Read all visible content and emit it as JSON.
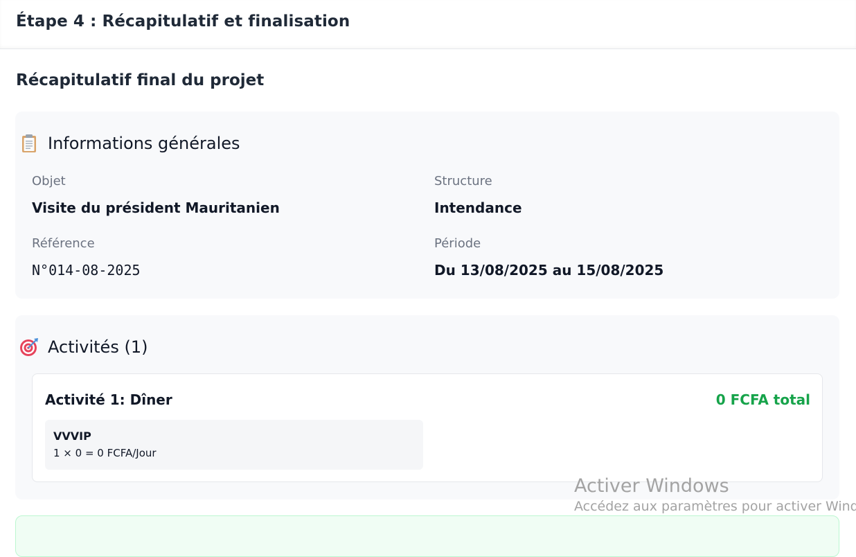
{
  "header": {
    "title": "Étape 4 : Récapitulatif et finalisation"
  },
  "summary": {
    "title": "Récapitulatif final du projet"
  },
  "general_info": {
    "icon": "clipboard-icon",
    "title": "Informations générales",
    "objet_label": "Objet",
    "objet_value": "Visite du président Mauritanien",
    "structure_label": "Structure",
    "structure_value": "Intendance",
    "reference_label": "Référence",
    "reference_value": "N°014-08-2025",
    "periode_label": "Période",
    "periode_value": "Du 13/08/2025 au 15/08/2025"
  },
  "activities": {
    "icon": "target-icon",
    "title": "Activités (1)",
    "items": [
      {
        "title": "Activité 1: Dîner",
        "total": "0 FCFA total",
        "lines": [
          {
            "name": "VVVIP",
            "calc": "1 × 0 = 0 FCFA/Jour"
          }
        ]
      }
    ]
  },
  "watermark": {
    "line1": "Activer Windows",
    "line2": "Accédez aux paramètres pour activer Windows."
  },
  "colors": {
    "total_green": "#16a34a",
    "card_bg": "#f8f9fb",
    "muted_label": "#6b7280"
  }
}
